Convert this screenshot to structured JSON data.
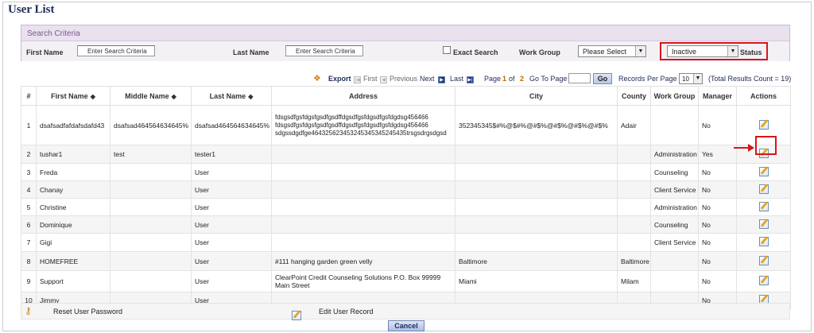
{
  "title": "User List",
  "search": {
    "header": "Search Criteria",
    "first_name_label": "First Name",
    "first_name_value": "Enter Search Criteria",
    "last_name_label": "Last Name",
    "last_name_value": "Enter Search Criteria",
    "exact_search_label": "Exact Search",
    "work_group_label": "Work Group",
    "work_group_value": "Please Select",
    "status_value": "Inactive",
    "status_label": "Status"
  },
  "pager": {
    "export_label": "Export",
    "first_label": "First",
    "previous_label": "Previous",
    "next_label": "Next",
    "last_label": "Last",
    "page_label": "Page",
    "current_page": "1",
    "of_label": "of",
    "total_pages": "2",
    "goto_label": "Go To Page",
    "go_label": "Go",
    "records_per_page_label": "Records Per Page",
    "records_per_page_value": "10",
    "total_results": "(Total Results Count = 19)"
  },
  "columns": [
    "#",
    "First Name",
    "Middle Name",
    "Last Name",
    "Address",
    "City",
    "County",
    "Work Group",
    "Manager",
    "Actions"
  ],
  "rows": [
    {
      "num": "1",
      "first": "dsafsadfafdafsdafd43",
      "middle": "dsafsad464564634645%",
      "last": "dsafsad464564634645%",
      "address": [
        "fdsgsdfgsfdgsfgsdfgsdffdgsdfgsfdgsdfgsfdgdsg456466",
        "fdsgsdfgsfdgsfgsdfgsdffdgsdfgsfdgsdfgsfdgdsg456466",
        "sdgssdgdfge464325623453245345345245435trsgsdrgsdgsd"
      ],
      "city": "352345345$#%@$#%@#$%@#$%@#$%@#$%",
      "county": "Adair",
      "workgroup": "",
      "manager": "No"
    },
    {
      "num": "2",
      "first": "tushar1",
      "middle": "test",
      "last": "tester1",
      "address": [],
      "city": "",
      "county": "",
      "workgroup": "Administration",
      "manager": "Yes"
    },
    {
      "num": "3",
      "first": "Freda",
      "middle": "",
      "last": "User",
      "address": [],
      "city": "",
      "county": "",
      "workgroup": "Counseling",
      "manager": "No"
    },
    {
      "num": "4",
      "first": "Chanay",
      "middle": "",
      "last": "User",
      "address": [],
      "city": "",
      "county": "",
      "workgroup": "Client Service",
      "manager": "No"
    },
    {
      "num": "5",
      "first": "Christine",
      "middle": "",
      "last": "User",
      "address": [],
      "city": "",
      "county": "",
      "workgroup": "Administration",
      "manager": "No"
    },
    {
      "num": "6",
      "first": "Dominique",
      "middle": "",
      "last": "User",
      "address": [],
      "city": "",
      "county": "",
      "workgroup": "Counseling",
      "manager": "No"
    },
    {
      "num": "7",
      "first": "Gigi",
      "middle": "",
      "last": "User",
      "address": [],
      "city": "",
      "county": "",
      "workgroup": "Client Service",
      "manager": "No"
    },
    {
      "num": "8",
      "first": "HOMEFREE",
      "middle": "",
      "last": "User",
      "address": [
        "#111 hanging garden green velly"
      ],
      "city": "Baltimore",
      "county": "Baltimore",
      "workgroup": "",
      "manager": "No"
    },
    {
      "num": "9",
      "first": "Support",
      "middle": "",
      "last": "User",
      "address": [
        "ClearPoint Credit Counseling Solutions P.O. Box 99999",
        "Main Street"
      ],
      "city": "Miami",
      "county": "Milam",
      "workgroup": "",
      "manager": "No"
    },
    {
      "num": "10",
      "first": "Jimmy",
      "middle": "",
      "last": "User",
      "address": [],
      "city": "",
      "county": "",
      "workgroup": "",
      "manager": "No"
    }
  ],
  "footer": {
    "reset_password_label": "Reset User Password",
    "edit_record_label": "Edit User Record"
  },
  "cancel_label": "Cancel",
  "colors": {
    "highlight": "#d9141b",
    "title": "#1d2b5a",
    "search_header_bg": "#e9e1ee",
    "button_blue": "#1d3a86"
  }
}
